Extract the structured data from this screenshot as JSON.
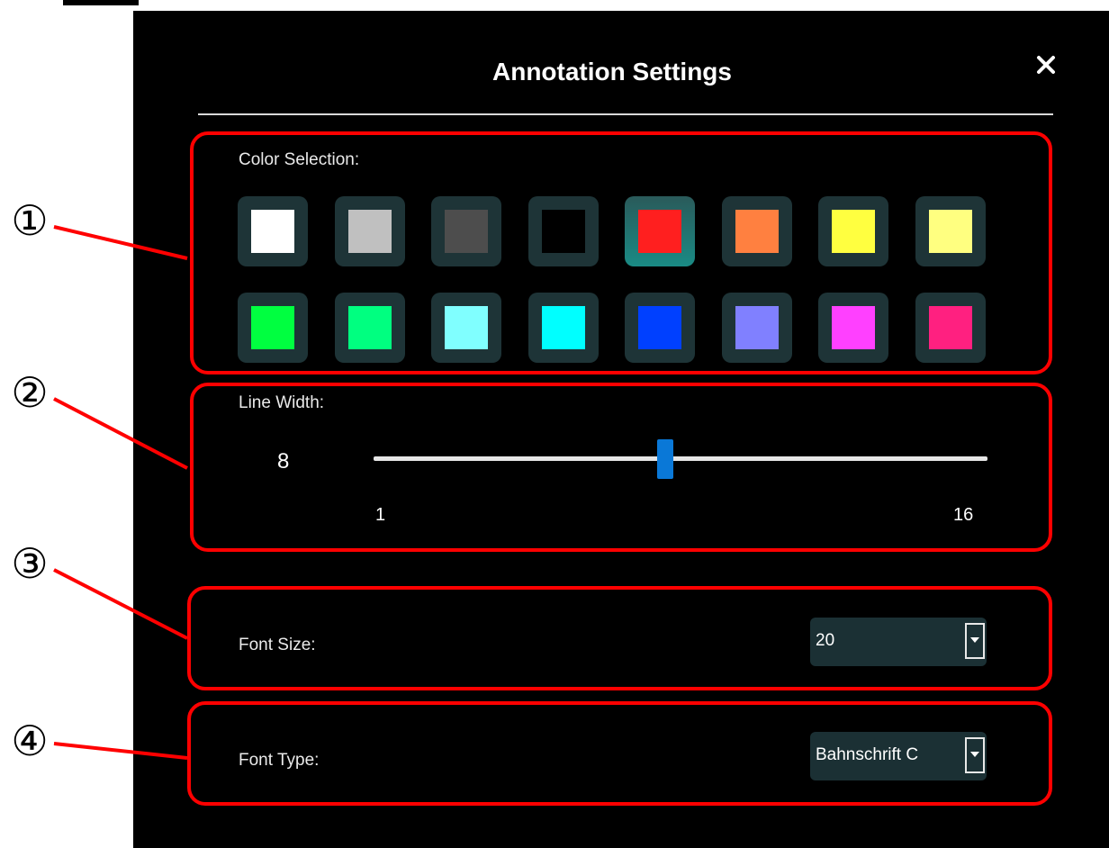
{
  "dialog": {
    "title": "Annotation Settings",
    "close_icon": "close-icon"
  },
  "color_selection": {
    "label": "Color Selection:",
    "selected_index": 4,
    "swatches": [
      "#ffffff",
      "#c0c0c0",
      "#4d4d4d",
      "#000000",
      "#ff1f1f",
      "#ff8040",
      "#ffff40",
      "#ffff80",
      "#00ff40",
      "#00ff80",
      "#80ffff",
      "#00ffff",
      "#0040ff",
      "#8080ff",
      "#ff40ff",
      "#ff2080"
    ]
  },
  "line_width": {
    "label": "Line Width:",
    "value": "8",
    "min": "1",
    "max": "16",
    "current": 8,
    "min_value": 1,
    "max_value": 16
  },
  "font_size": {
    "label": "Font Size:",
    "value": "20"
  },
  "font_type": {
    "label": "Font Type:",
    "value": "Bahnschrift C"
  },
  "callouts": {
    "one": "①",
    "two": "②",
    "three": "③",
    "four": "④"
  },
  "colors": {
    "panel_bg": "#000000",
    "swatch_bg": "#1e3437",
    "selected_swatch_bg": "#1a8b85",
    "slider_thumb": "#0a78d7",
    "callout_red": "#ff0000"
  }
}
